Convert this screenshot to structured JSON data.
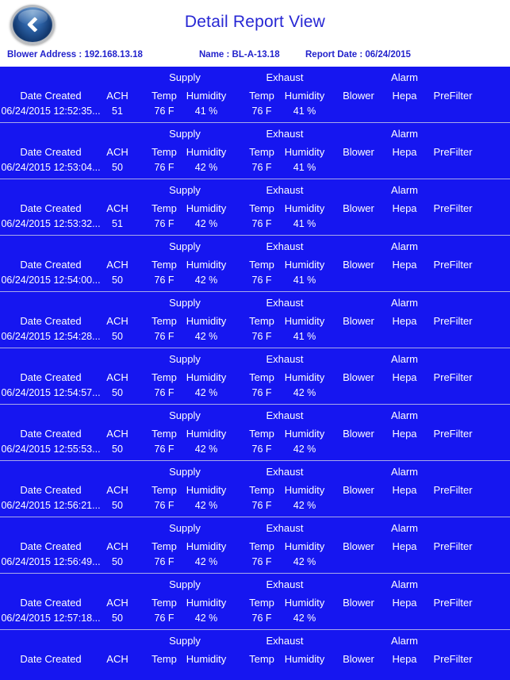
{
  "navbar": {
    "back_label": "Back",
    "title": "Detail Report View"
  },
  "subheader": {
    "blower_address": "Blower Address : 192.168.13.18",
    "name": "Name : BL-A-13.18",
    "report_date": "Report Date : 06/24/2015"
  },
  "table": {
    "group_headers": {
      "supply": "Supply",
      "exhaust": "Exhaust",
      "alarm": "Alarm"
    },
    "columns": {
      "date_created": "Date Created",
      "ach": "ACH",
      "supply_temp": "Temp",
      "supply_humidity": "Humidity",
      "exhaust_temp": "Temp",
      "exhaust_humidity": "Humidity",
      "blower": "Blower",
      "hepa": "Hepa",
      "prefilter": "PreFilter"
    },
    "rows": [
      {
        "date_created": "06/24/2015 12:52:35...",
        "ach": "51",
        "supply_temp": "76 F",
        "supply_humidity": "41 %",
        "exhaust_temp": "76 F",
        "exhaust_humidity": "41 %",
        "blower": "",
        "hepa": "",
        "prefilter": ""
      },
      {
        "date_created": "06/24/2015 12:53:04...",
        "ach": "50",
        "supply_temp": "76 F",
        "supply_humidity": "42 %",
        "exhaust_temp": "76 F",
        "exhaust_humidity": "41 %",
        "blower": "",
        "hepa": "",
        "prefilter": ""
      },
      {
        "date_created": "06/24/2015 12:53:32...",
        "ach": "51",
        "supply_temp": "76 F",
        "supply_humidity": "42 %",
        "exhaust_temp": "76 F",
        "exhaust_humidity": "41 %",
        "blower": "",
        "hepa": "",
        "prefilter": ""
      },
      {
        "date_created": "06/24/2015 12:54:00...",
        "ach": "50",
        "supply_temp": "76 F",
        "supply_humidity": "42 %",
        "exhaust_temp": "76 F",
        "exhaust_humidity": "41 %",
        "blower": "",
        "hepa": "",
        "prefilter": ""
      },
      {
        "date_created": "06/24/2015 12:54:28...",
        "ach": "50",
        "supply_temp": "76 F",
        "supply_humidity": "42 %",
        "exhaust_temp": "76 F",
        "exhaust_humidity": "41 %",
        "blower": "",
        "hepa": "",
        "prefilter": ""
      },
      {
        "date_created": "06/24/2015 12:54:57...",
        "ach": "50",
        "supply_temp": "76 F",
        "supply_humidity": "42 %",
        "exhaust_temp": "76 F",
        "exhaust_humidity": "42 %",
        "blower": "",
        "hepa": "",
        "prefilter": ""
      },
      {
        "date_created": "06/24/2015 12:55:53...",
        "ach": "50",
        "supply_temp": "76 F",
        "supply_humidity": "42 %",
        "exhaust_temp": "76 F",
        "exhaust_humidity": "42 %",
        "blower": "",
        "hepa": "",
        "prefilter": ""
      },
      {
        "date_created": "06/24/2015 12:56:21...",
        "ach": "50",
        "supply_temp": "76 F",
        "supply_humidity": "42 %",
        "exhaust_temp": "76 F",
        "exhaust_humidity": "42 %",
        "blower": "",
        "hepa": "",
        "prefilter": ""
      },
      {
        "date_created": "06/24/2015 12:56:49...",
        "ach": "50",
        "supply_temp": "76 F",
        "supply_humidity": "42 %",
        "exhaust_temp": "76 F",
        "exhaust_humidity": "42 %",
        "blower": "",
        "hepa": "",
        "prefilter": ""
      },
      {
        "date_created": "06/24/2015 12:57:18...",
        "ach": "50",
        "supply_temp": "76 F",
        "supply_humidity": "42 %",
        "exhaust_temp": "76 F",
        "exhaust_humidity": "42 %",
        "blower": "",
        "hepa": "",
        "prefilter": ""
      },
      {
        "date_created": "Date Created",
        "ach": "ACH",
        "supply_temp": "Temp",
        "supply_humidity": "Humidity",
        "exhaust_temp": "Temp",
        "exhaust_humidity": "Humidity",
        "blower": "Blower",
        "hepa": "Hepa",
        "prefilter": "PreFilter"
      }
    ]
  },
  "colors": {
    "table_background": "#1616F0",
    "title_text": "#2727D4",
    "subheader_text": "#2222CC",
    "row_divider": "#A9A9E8",
    "cell_text": "#FFFFFF"
  }
}
